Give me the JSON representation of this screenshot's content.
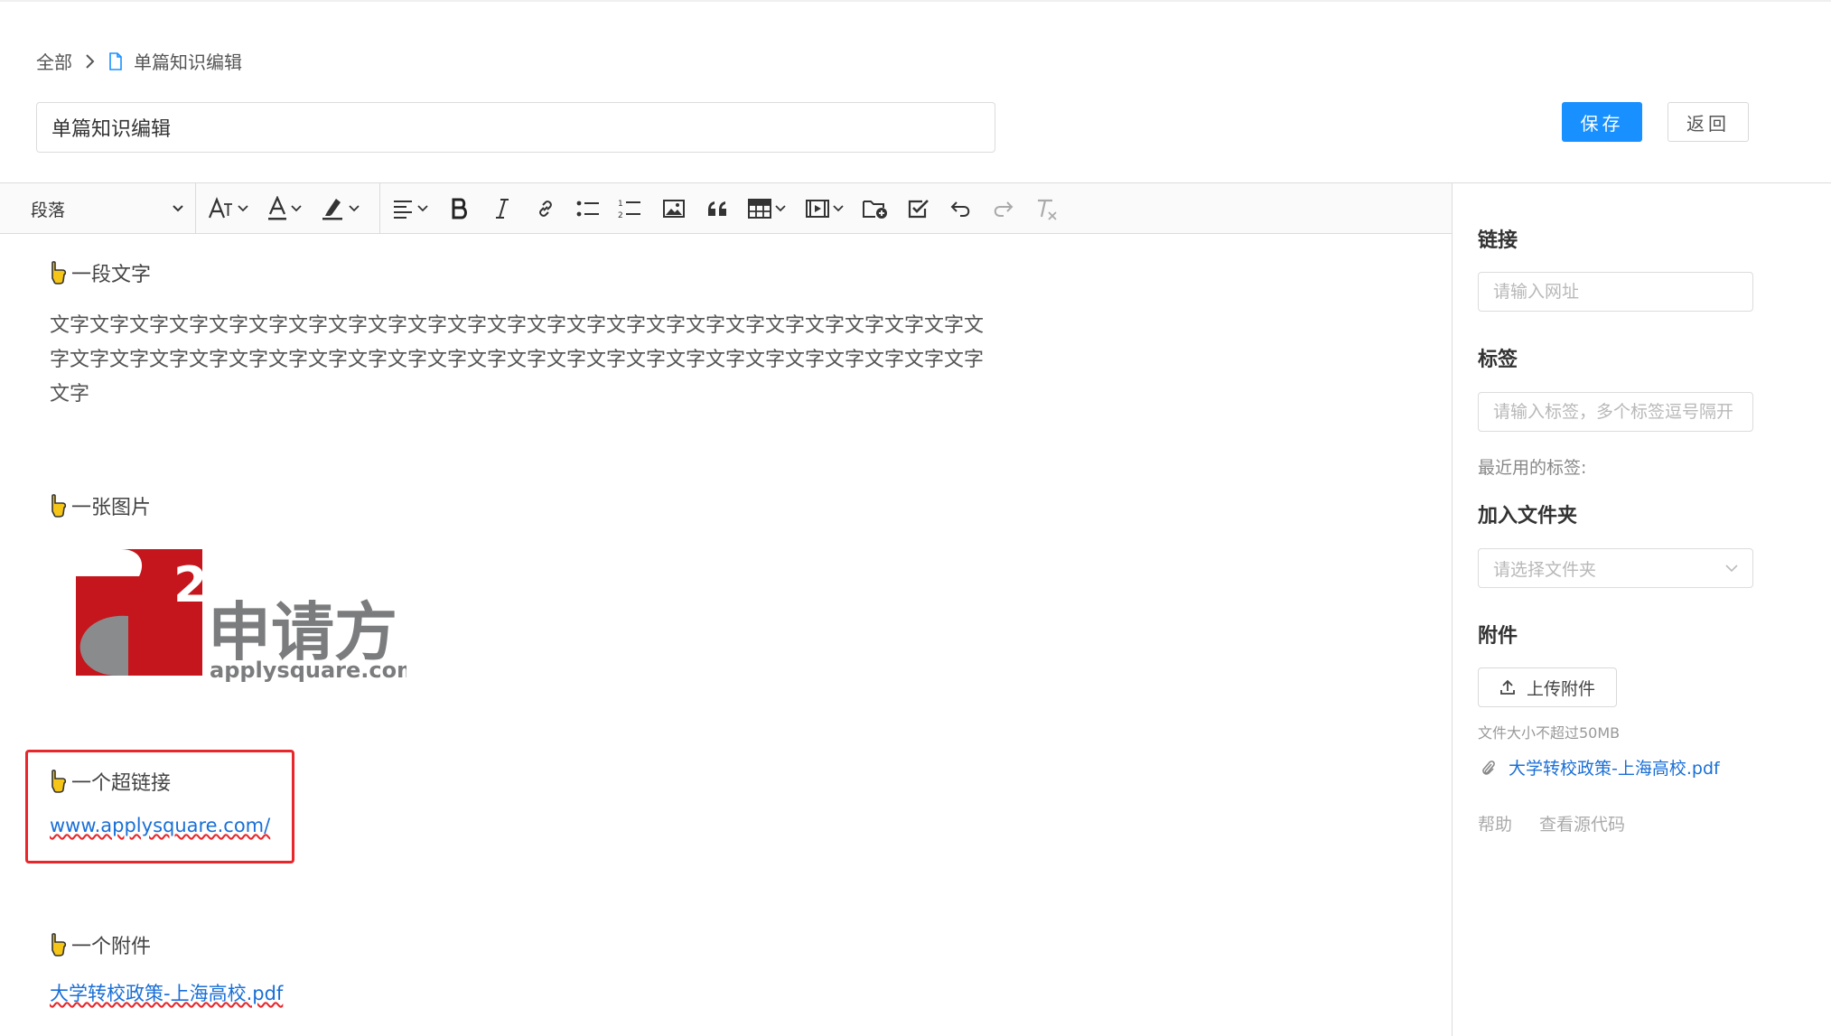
{
  "breadcrumb": {
    "root": "全部",
    "current": "单篇知识编辑"
  },
  "title_input": {
    "value": "单篇知识编辑"
  },
  "actions": {
    "save": "保存",
    "back": "返回"
  },
  "toolbar": {
    "paragraph_select": "段落",
    "icons": [
      "font-size-icon",
      "font-color-icon",
      "highlight-icon",
      "align-icon",
      "bold-icon",
      "italic-icon",
      "link-icon",
      "bullet-list-icon",
      "numbered-list-icon",
      "image-icon",
      "quote-icon",
      "table-icon",
      "video-icon",
      "folder-add-icon",
      "checkbox-icon",
      "undo-icon",
      "redo-icon",
      "clear-format-icon"
    ]
  },
  "content": {
    "section1_title": "一段文字",
    "section1_text": "文字文字文字文字文字文字文字文字文字文字文字文字文字文字文字文字文字文字文字文字文字文字文字文字文字文字文字文字文字文字文字文字文字文字文字文字文字文字文字文字文字文字文字文字文字文字文字文字",
    "section2_title": "一张图片",
    "logo": {
      "superscript": "2",
      "name_cn": "申请方",
      "domain": "applysquare.com"
    },
    "section3_title": "一个超链接",
    "link_text": "www.applysquare.com/",
    "section4_title": "一个附件",
    "attachment_text": "大学转校政策-上海高校.pdf"
  },
  "sidebar": {
    "link_label": "链接",
    "link_placeholder": "请输入网址",
    "tags_label": "标签",
    "tags_placeholder": "请输入标签，多个标签逗号隔开",
    "recent_tags_label": "最近用的标签:",
    "folder_label": "加入文件夹",
    "folder_placeholder": "请选择文件夹",
    "attachment_label": "附件",
    "upload_button": "上传附件",
    "size_note": "文件大小不超过50MB",
    "attachment_file": "大学转校政策-上海高校.pdf",
    "help": "帮助",
    "view_source": "查看源代码"
  },
  "colors": {
    "primary": "#1890ff",
    "link": "#1a6fd6",
    "highlight_border": "#e8262b",
    "logo_red": "#c4161c",
    "logo_gray": "#8a8b8d"
  }
}
